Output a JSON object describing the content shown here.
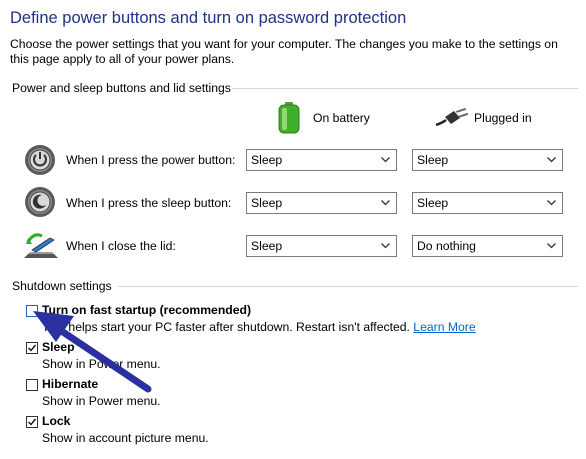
{
  "page": {
    "title": "Define power buttons and turn on password protection",
    "description": "Choose the power settings that you want for your computer. The changes you make to the settings on this page apply to all of your power plans."
  },
  "power_group": {
    "heading": "Power and sleep buttons and lid settings",
    "col_battery": "On battery",
    "col_plugged": "Plugged in",
    "rows": [
      {
        "label": "When I press the power button:",
        "battery": "Sleep",
        "plugged": "Sleep",
        "icon": "power-button-icon"
      },
      {
        "label": "When I press the sleep button:",
        "battery": "Sleep",
        "plugged": "Sleep",
        "icon": "sleep-button-icon"
      },
      {
        "label": "When I close the lid:",
        "battery": "Sleep",
        "plugged": "Do nothing",
        "icon": "laptop-lid-icon"
      }
    ]
  },
  "shutdown_group": {
    "heading": "Shutdown settings",
    "fast_startup": {
      "label": "Turn on fast startup (recommended)",
      "checked": false,
      "desc": "This helps start your PC faster after shutdown. Restart isn't affected.",
      "link": "Learn More"
    },
    "sleep": {
      "label": "Sleep",
      "checked": true,
      "desc": "Show in Power menu."
    },
    "hibernate": {
      "label": "Hibernate",
      "checked": false,
      "desc": "Show in Power menu."
    },
    "lock": {
      "label": "Lock",
      "checked": true,
      "desc": "Show in account picture menu."
    }
  },
  "colors": {
    "title": "#1e3287",
    "link": "#0066cc",
    "arrow": "#2c2fa0",
    "battery": "#3fae2a"
  }
}
